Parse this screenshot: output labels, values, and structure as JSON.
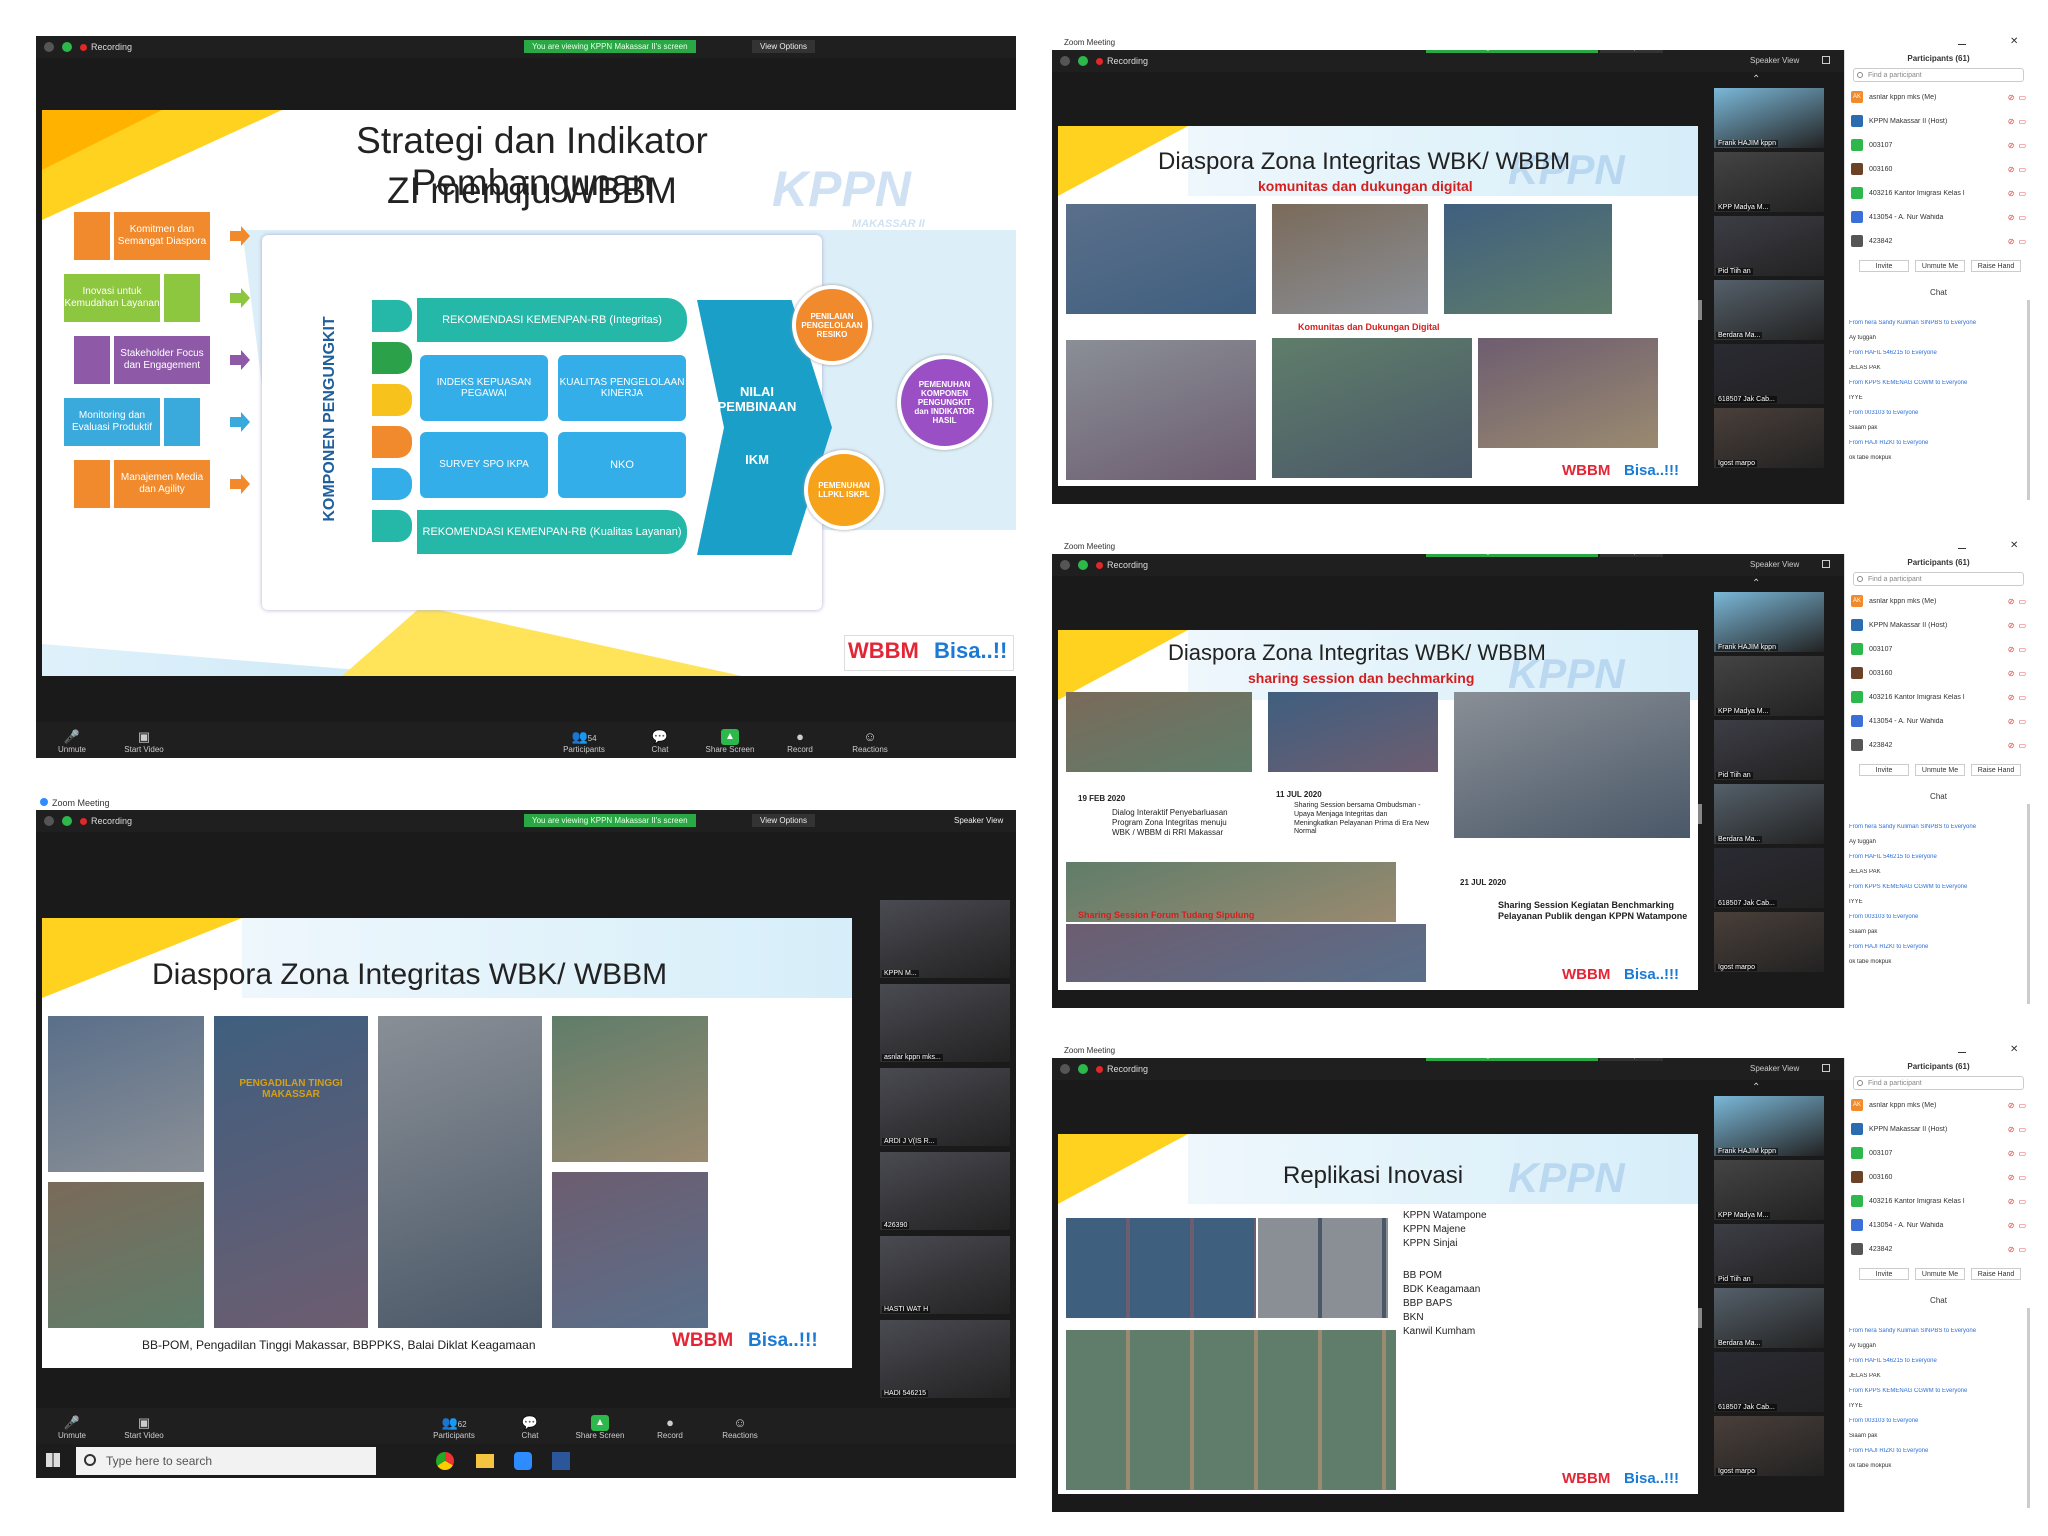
{
  "zoom": {
    "recording": "Recording",
    "viewing_banner": "You are viewing KPPN Makassar II's screen",
    "view_options": "View Options",
    "window_title": "Zoom Meeting",
    "speaker_view": "Speaker View",
    "toolbar": {
      "unmute": "Unmute",
      "start_video": "Start Video",
      "participants": "Participants",
      "participants_count_1": "54",
      "participants_count_2": "62",
      "chat": "Chat",
      "share_screen": "Share Screen",
      "record": "Record",
      "reactions": "Reactions"
    }
  },
  "slide1": {
    "title_line1": "Strategi dan Indikator Pembangunan",
    "title_line2": "ZI menuju WBBM",
    "watermark": "KPPN",
    "watermark_sub": "MAKASSAR II",
    "left_items": [
      {
        "label": "Komitmen dan Semangat Diaspora",
        "icon": "handshake-icon",
        "color": "#f08a2c"
      },
      {
        "label": "Inovasi untuk Kemudahan Layanan",
        "icon": "lightbulb-icon",
        "color": "#8dc63f"
      },
      {
        "label": "Stakeholder Focus dan Engagement",
        "icon": "people-icon",
        "color": "#8e5aa8"
      },
      {
        "label": "Monitoring dan Evaluasi Produktif",
        "icon": "monitor-people-icon",
        "color": "#3aa9dc"
      },
      {
        "label": "Manajemen Media dan Agility",
        "icon": "media-icon",
        "color": "#f08a2c"
      }
    ],
    "vertical_label": "KOMPONEN PENGUNGKIT",
    "center_boxes": {
      "rek_integritas": "REKOMENDASI KEMENPAN-RB (Integritas)",
      "ikp": "INDEKS KEPUASAN PEGAWAI",
      "kualitas": "KUALITAS PENGELOLAAN KINERJA",
      "survey": "SURVEY SPO IKPA",
      "nko": "NKO",
      "rek_layanan": "REKOMENDASI KEMENPAN-RB (Kualitas Layanan)"
    },
    "nilai": "NILAI PEMBINAAN",
    "ikm": "IKM",
    "circles": [
      {
        "label": "PENILAIAN PENGELOLAAN RESIKO",
        "color": "#f08a2c"
      },
      {
        "label": "PEMENUHAN KOMPONEN PENGUNGKIT dan INDIKATOR HASIL",
        "color": "#9b4fc4"
      },
      {
        "label": "PEMENUHAN LLPKL ISKPL",
        "color": "#f7a21b"
      }
    ],
    "footer_wbbm": "WBBM",
    "footer_bisa": "Bisa..!!"
  },
  "slide2": {
    "title": "Diaspora Zona Integritas WBK/ WBBM",
    "subtitle": "komunitas dan dukungan digital",
    "caption": "Komunitas dan Dukungan Digital",
    "footer_wbbm": "WBBM",
    "footer_bisa": "Bisa..!!!"
  },
  "slide3": {
    "title": "Diaspora Zona Integritas WBK/ WBBM",
    "subtitle": "sharing session dan bechmarking",
    "date1": "19 FEB 2020",
    "desc1": "Dialog Interaktif Penyebarluasan Program Zona Integritas menuju WBK / WBBM di RRI Makassar",
    "date2": "11 JUL 2020",
    "desc2": "Sharing Session bersama Ombudsman - Upaya Menjaga Integritas dan Meningkatkan Pelayanan Prima di Era New Normal",
    "forum": "Sharing Session Forum Tudang Sipulung",
    "date3": "21 JUL 2020",
    "desc3": "Sharing Session Kegiatan Benchmarking Pelayanan Publik dengan KPPN Watampone",
    "footer_wbbm": "WBBM",
    "footer_bisa": "Bisa..!!!"
  },
  "slide4": {
    "title": "Diaspora Zona Integritas WBK/ WBBM",
    "caption": "BB-POM, Pengadilan Tinggi Makassar, BBPPKS, Balai Diklat Keagamaan",
    "sign": "PENGADILAN TINGGI MAKASSAR",
    "footer_wbbm": "WBBM",
    "footer_bisa": "Bisa..!!!"
  },
  "slide5": {
    "title": "Replikasi Inovasi",
    "list1": [
      "KPPN Watampone",
      "KPPN Majene",
      "KPPN Sinjai"
    ],
    "list2": [
      "BB POM",
      "BDK Keagamaan",
      "BBP BAPS",
      "BKN",
      "Kanwil Kumham"
    ],
    "footer_wbbm": "WBBM",
    "footer_bisa": "Bisa..!!!"
  },
  "side_panel": {
    "participants_title": "Participants (61)",
    "find_placeholder": "Find a participant",
    "participants": [
      {
        "name": "asnlar kppn mks (Me)",
        "color": "#f08a2c",
        "initials": "AK"
      },
      {
        "name": "KPPN Makassar II (Host)",
        "color": "#2b6cb0",
        "initials": ""
      },
      {
        "name": "003107",
        "color": "#2db84b",
        "initials": ""
      },
      {
        "name": "003160",
        "color": "#6b4226",
        "initials": ""
      },
      {
        "name": "403216 Kantor Imigrasi Kelas I",
        "color": "#2db84b",
        "initials": ""
      },
      {
        "name": "413054 - A. Nur Wahida",
        "color": "#3a6fd8",
        "initials": ""
      },
      {
        "name": "423842",
        "color": "#555555",
        "initials": ""
      }
    ],
    "invite": "Invite",
    "unmute_me": "Unmute Me",
    "raise_hand": "Raise Hand",
    "chat_title": "Chat",
    "chat_lines": [
      "From hera Sandy Kuliman SINPBS to Everyone",
      "Ay tuggah",
      "From HAFIL 546215 to Everyone",
      "JELAS PAK",
      "From KPPS KEMENAG CGWM to Everyone",
      "IYYE",
      "From 003103 to Everyone",
      "Siaam pak",
      "From HAJI RIZKI to Everyone",
      "ok tabe mokpuk"
    ]
  },
  "thumb_names": [
    "Frank HAJIM kppn",
    "KPP Madya M...",
    "Pid Tiih an",
    "Berdara Ma...",
    "618507 Jak Cab...",
    "Igost marpo"
  ],
  "slide4_thumbs": [
    "KPPN M...",
    "asnlar kppn mks...",
    "ARDI J V(IS R...",
    "426390",
    "HASTI WAT H",
    "HADI 546215"
  ],
  "taskbar": {
    "search_placeholder": "Type here to search"
  }
}
